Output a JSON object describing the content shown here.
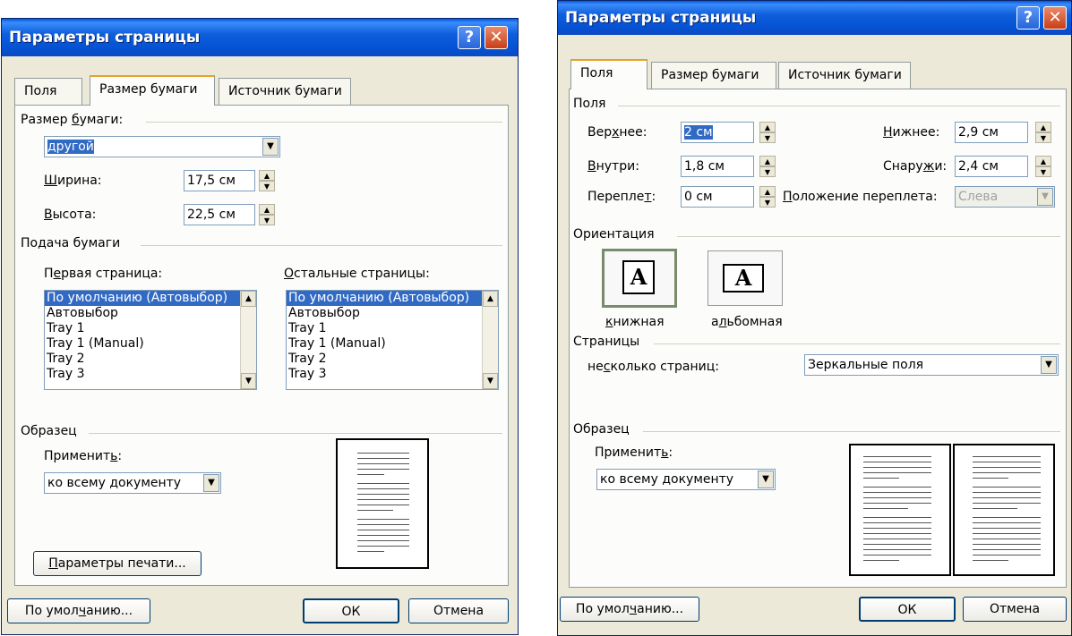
{
  "left": {
    "title": "Параметры страницы",
    "tabs": [
      "Поля",
      "Размер бумаги",
      "Источник бумаги"
    ],
    "paper_size": {
      "label_pre": "Размер ",
      "label_u": "б",
      "label_post": "умаги:",
      "value": "другой",
      "width_label_u": "Ш",
      "width_label_post": "ирина:",
      "width_value": "17,5 см",
      "height_label_u": "В",
      "height_label_post": "ысота:",
      "height_value": "22,5 см"
    },
    "feed": {
      "label": "Подача бумаги",
      "first_pre": "П",
      "first_u": "е",
      "first_post": "рвая страница:",
      "other_u": "О",
      "other_post": "стальные страницы:",
      "items": [
        "По умолчанию (Автовыбор)",
        "Автовыбор",
        "Tray 1",
        "Tray 1 (Manual)",
        "Tray 2",
        "Tray 3"
      ]
    },
    "sample": {
      "label": "Образец",
      "apply_pre": "Применит",
      "apply_u": "ь",
      "apply_post": ":",
      "apply_value": "ко всему документу"
    },
    "print_btn_u": "П",
    "print_btn_post": "араметры печати...",
    "default_pre": "По умол",
    "default_u": "ч",
    "default_post": "анию...",
    "ok": "ОК",
    "cancel": "Отмена"
  },
  "right": {
    "title": "Параметры страницы",
    "tabs": [
      "Поля",
      "Размер бумаги",
      "Источник бумаги"
    ],
    "margins": {
      "label": "Поля",
      "top_pre": "Вер",
      "top_u": "х",
      "top_post": "нее:",
      "top_value": "2 см",
      "bottom_u": "Н",
      "bottom_post": "ижнее:",
      "bottom_value": "2,9 см",
      "inside_u": "В",
      "inside_post": "нутри:",
      "inside_value": "1,8 см",
      "outside_pre": "Снару",
      "outside_u": "ж",
      "outside_post": "и:",
      "outside_value": "2,4 см",
      "gutter_pre": "Перепле",
      "gutter_u": "т",
      "gutter_post": ":",
      "gutter_value": "0 см",
      "gutter_pos_u": "П",
      "gutter_pos_post": "оложение переплета:",
      "gutter_pos_value": "Слева"
    },
    "orientation": {
      "label": "Ориентация",
      "portrait_u": "к",
      "portrait_post": "нижная",
      "landscape_pre": "а",
      "landscape_u": "л",
      "landscape_post": "ьбомная",
      "glyph": "A"
    },
    "pages": {
      "label": "Страницы",
      "multi_pre": "не",
      "multi_u": "с",
      "multi_post": "колько страниц:",
      "multi_value": "Зеркальные поля"
    },
    "sample": {
      "label": "Образец",
      "apply_pre": "Применит",
      "apply_u": "ь",
      "apply_post": ":",
      "apply_value": "ко всему документу"
    },
    "default_pre": "По умол",
    "default_u": "ч",
    "default_post": "анию...",
    "ok": "ОК",
    "cancel": "Отмена"
  }
}
